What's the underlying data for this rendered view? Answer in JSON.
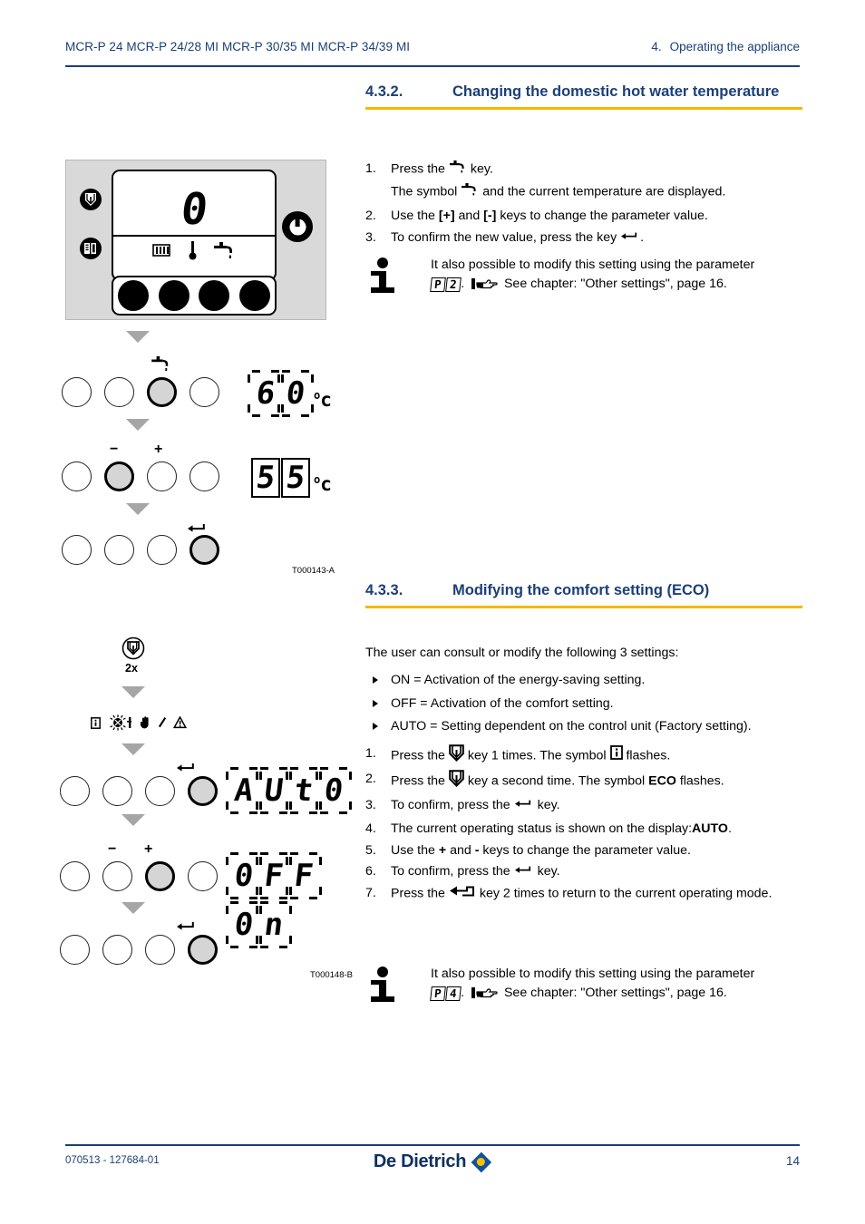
{
  "header": {
    "models": "MCR-P 24 MCR-P 24/28 MI MCR-P 30/35 MI MCR-P 34/39 MI",
    "chapter_number": "4.",
    "chapter_title": "Operating the appliance"
  },
  "footer": {
    "doc_code": "070513 - 127684-01",
    "brand": "De Dietrich",
    "page": "14"
  },
  "section_432": {
    "number": "4.3.2.",
    "title": "Changing the domestic hot water temperature",
    "steps": [
      {
        "num": "1.",
        "text_before": "Press the",
        "icon": "tap-icon",
        "text_after": "key."
      },
      {
        "num": "",
        "text_before": "The symbol",
        "icon": "tap-icon",
        "text_after": "and the current temperature are displayed."
      },
      {
        "num": "2.",
        "text_before": "Use the",
        "bold1": "[+]",
        "mid": "and",
        "bold2": "[-]",
        "text_after": "keys to change the parameter value."
      },
      {
        "num": "3.",
        "text_before": "To confirm the new value, press the key",
        "icon": "enter-arrow-icon",
        "text_after": "."
      }
    ],
    "note": {
      "line1": "It also possible to modify this setting using the parameter",
      "param_char1": "P",
      "param_char2": "2",
      "after_param": ".",
      "see_chapter": "See chapter:  \"Other settings\", page 16."
    },
    "figure": {
      "code": "T000143-A",
      "panel": {
        "display_digit": "0",
        "icons": [
          "radiator-icon",
          "thermometer-icon",
          "tap-icon"
        ],
        "left_icons": [
          "mode-icon",
          "menu-icon"
        ],
        "power_icon": "power-icon",
        "buttons": 4
      },
      "step_a": {
        "key_icon": "tap-icon",
        "selected_index": 2,
        "display": "60",
        "unit": "°C"
      },
      "step_b": {
        "minus_label": "−",
        "plus_label": "+",
        "selected_index": 1,
        "display": "55",
        "unit": "°C"
      },
      "step_c": {
        "key_icon": "enter-arrow-icon",
        "selected_index": 3
      }
    }
  },
  "section_433": {
    "number": "4.3.3.",
    "title": "Modifying the comfort setting (ECO)",
    "intro": "The user can consult or modify the following 3 settings:",
    "bullets": [
      "ON = Activation of the energy-saving setting.",
      "OFF = Activation of the comfort setting.",
      "AUTO = Setting dependent on the control unit (Factory setting)."
    ],
    "steps": [
      {
        "num": "1.",
        "parts": [
          "Press the",
          "{mode-icon}",
          "key 1 times. The symbol",
          "{info-box-icon}",
          "flashes."
        ]
      },
      {
        "num": "2.",
        "parts": [
          "Press the",
          "{mode-icon}",
          "key a second time. The symbol",
          "{b:ECO}",
          "flashes."
        ]
      },
      {
        "num": "3.",
        "parts": [
          "To confirm, press the",
          "{enter-arrow-icon}",
          "key."
        ]
      },
      {
        "num": "4.",
        "parts": [
          "The current operating status is shown on the display:",
          "{b:AUTO}",
          "."
        ]
      },
      {
        "num": "5.",
        "parts": [
          "Use the",
          "{b:+}",
          "and",
          "{b:-}",
          "keys to change the parameter value."
        ]
      },
      {
        "num": "6.",
        "parts": [
          "To confirm, press the",
          "{enter-arrow-icon}",
          "key."
        ]
      },
      {
        "num": "7.",
        "parts": [
          "Press the",
          "{escape-arrow-icon}",
          "key 2 times to return to the current operating mode."
        ]
      }
    ],
    "note": {
      "line1": "It also possible to modify this setting using the parameter",
      "param_char1": "P",
      "param_char2": "4",
      "after_param": ".",
      "see_chapter": "See chapter:  \"Other settings\", page 16."
    },
    "figure": {
      "code": "T000148-B",
      "press_count": "2x",
      "mode_icon": "mode-icon",
      "status_icons": [
        "info-box-icon",
        "eco-flashing-icon",
        "person-icon",
        "hand-icon",
        "wrench-icon",
        "warning-icon"
      ],
      "step_a": {
        "key_icon": "enter-arrow-icon",
        "selected_index": 3,
        "display": "AUTO"
      },
      "step_b": {
        "minus_label": "−",
        "plus_label": "+",
        "selected_index": 2,
        "display_1": "OFF",
        "display_2": "ON"
      },
      "step_c": {
        "key_icon": "enter-arrow-icon",
        "selected_index": 3
      }
    }
  },
  "colors": {
    "heading_blue": "#1b3f78",
    "accent_yellow": "#f5b800",
    "brand_blue": "#1450a0",
    "brand_yellow": "#f5c400"
  }
}
